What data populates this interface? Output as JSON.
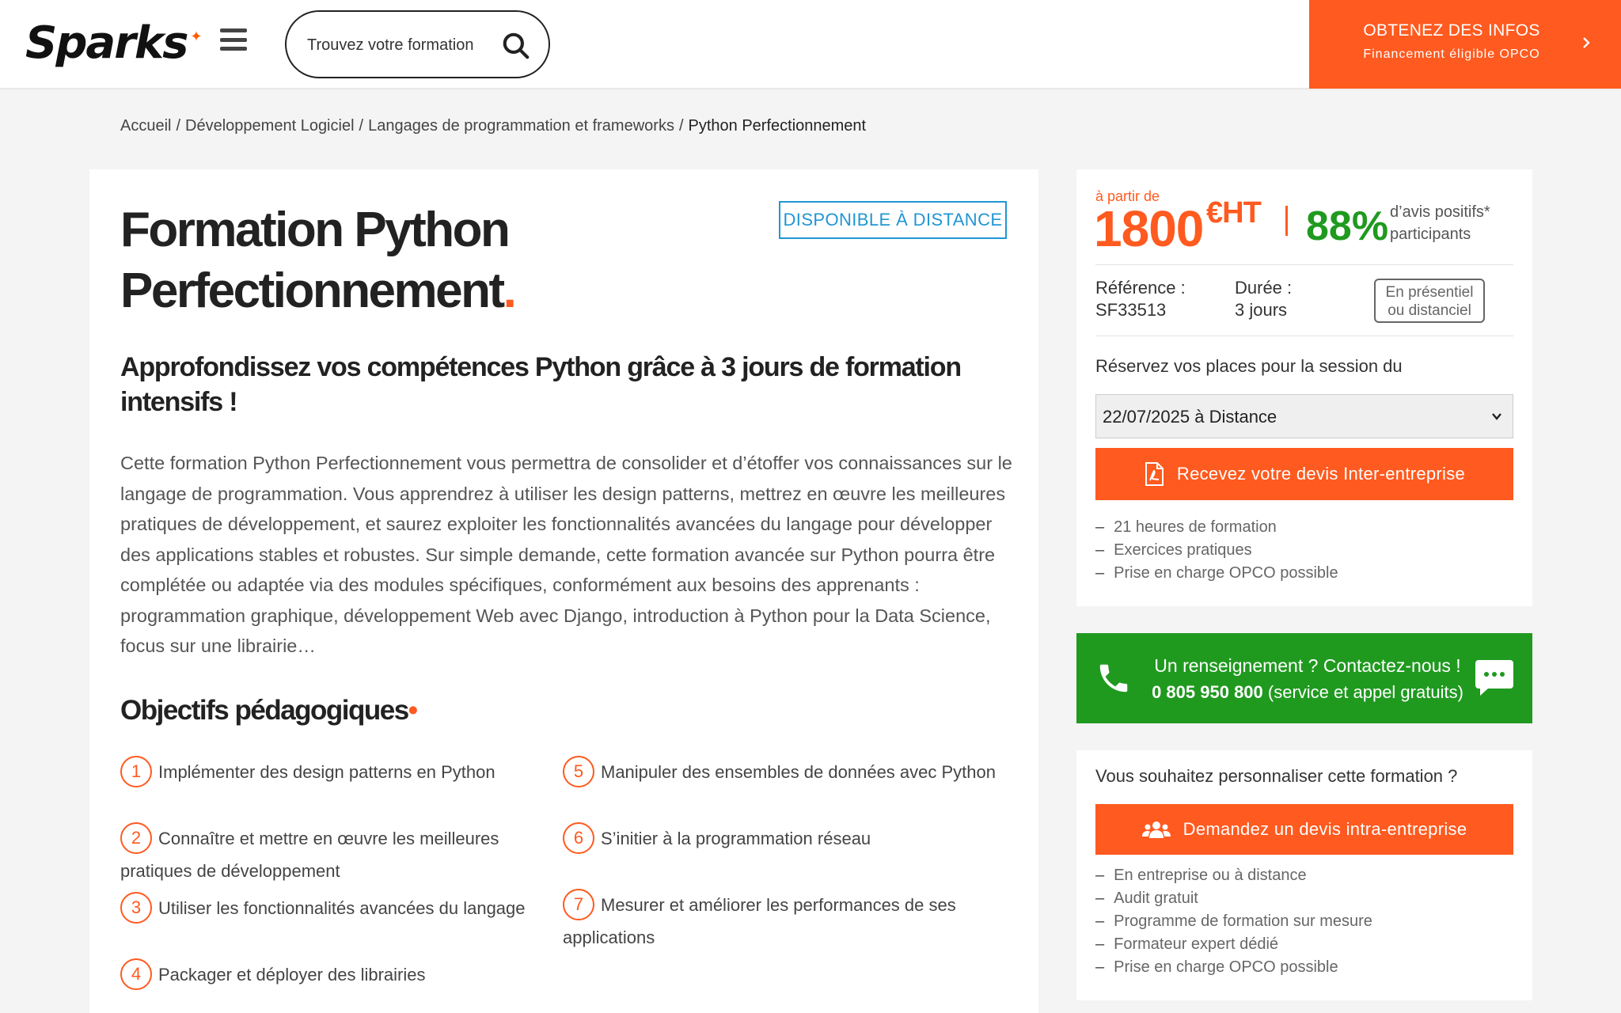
{
  "header": {
    "logo_text": "Sparks",
    "search_placeholder": "Trouvez votre formation",
    "cta_title": "OBTENEZ DES INFOS",
    "cta_subtitle": "Financement éligible OPCO"
  },
  "breadcrumb": {
    "items": [
      "Accueil",
      "Développement Logiciel",
      "Langages de programmation et frameworks"
    ],
    "current": "Python Perfectionnement"
  },
  "main": {
    "badge": "DISPONIBLE À DISTANCE",
    "title_line1": "Formation Python",
    "title_line2": "Perfectionnement",
    "title_dot": ".",
    "subtitle": "Approfondissez vos compétences Python grâce à 3 jours de formation intensifs !",
    "description": "Cette formation Python Perfectionnement vous permettra de consolider et d’étoffer vos connaissances sur le langage de programmation. Vous apprendrez à utiliser les design patterns, mettrez en œuvre les meilleures pratiques de développement, et saurez exploiter les fonctionnalités avancées du langage pour développer des applications stables et robustes. Sur simple demande, cette formation avancée sur Python pourra être complétée ou adaptée via des modules spécifiques, conformément aux besoins des apprenants : programmation graphique, développement Web avec Django, introduction à Python pour la Data Science, focus sur une librairie…",
    "objectives_title": "Objectifs pédagogiques",
    "objectives": [
      {
        "num": "1",
        "text": "Implémenter des design patterns en Python"
      },
      {
        "num": "2",
        "text": "Connaître et mettre en œuvre les meilleures pratiques de développement"
      },
      {
        "num": "3",
        "text": "Utiliser les fonctionnalités avancées du langage"
      },
      {
        "num": "4",
        "text": "Packager et déployer des librairies"
      },
      {
        "num": "5",
        "text": "Manipuler des ensembles de données avec Python"
      },
      {
        "num": "6",
        "text": "S’initier à la programmation réseau"
      },
      {
        "num": "7",
        "text": "Mesurer et améliorer les performances de ses applications"
      }
    ]
  },
  "pricing": {
    "from_label": "à partir de",
    "price": "1800",
    "unit": "€HT",
    "rating": "88%",
    "rating_label_1": "d’avis positifs*",
    "rating_label_2": "participants",
    "ref_label": "Référence :",
    "ref_value": "SF33513",
    "duration_label": "Durée :",
    "duration_value": "3 jours",
    "mode_line1": "En présentiel",
    "mode_line2": "ou distanciel",
    "session_label": "Réservez vos places pour la session du",
    "session_selected": "22/07/2025 à Distance",
    "quote_button": "Recevez votre devis Inter-entreprise",
    "features": [
      "21 heures de formation",
      "Exercices pratiques",
      "Prise en charge OPCO possible"
    ]
  },
  "contact": {
    "question": "Un renseignement ?",
    "cta": "Contactez-nous !",
    "phone": "0 805 950 800",
    "phone_note": "(service et appel gratuits)"
  },
  "custom": {
    "title": "Vous souhaitez personnaliser cette formation ?",
    "button": "Demandez un devis intra-entreprise",
    "features": [
      "En entreprise ou à distance",
      "Audit gratuit",
      "Programme de formation sur mesure",
      "Formateur expert dédié",
      "Prise en charge OPCO possible"
    ]
  },
  "colors": {
    "accent": "#ff5a1f",
    "green": "#1f9a1f",
    "badge_blue": "#2196d3"
  },
  "icons": [
    "burger-menu-icon",
    "search-icon",
    "chevron-right-icon",
    "pdf-file-icon",
    "phone-icon",
    "chat-bubble-icon",
    "group-users-icon",
    "chevron-down-icon"
  ]
}
